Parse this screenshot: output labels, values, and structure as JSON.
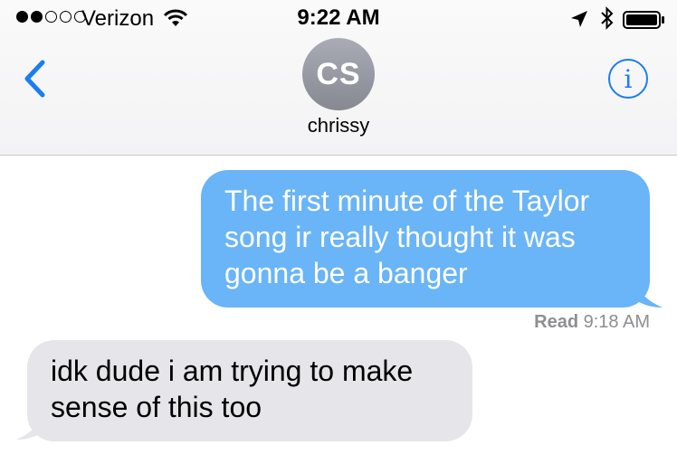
{
  "status_bar": {
    "carrier": "Verizon",
    "time": "9:22 AM",
    "signal_bars_filled": 2,
    "signal_bars_total": 5
  },
  "nav": {
    "contact_initials": "CS",
    "contact_name": "chrissy",
    "back_icon": "chevron-left-icon",
    "info_icon": "info-icon",
    "info_glyph": "i"
  },
  "messages": [
    {
      "direction": "sent",
      "text": "The first minute of the Taylor song ir really thought it was gonna be a banger"
    },
    {
      "direction": "received",
      "text": "idk dude i am trying to make sense of this too"
    }
  ],
  "receipt": {
    "label": "Read",
    "time": "9:18 AM"
  },
  "colors": {
    "accent": "#1a7df5",
    "sent_bubble": "#6ab4f8",
    "received_bubble": "#e5e5ea",
    "receipt_text": "#8e8e93"
  }
}
